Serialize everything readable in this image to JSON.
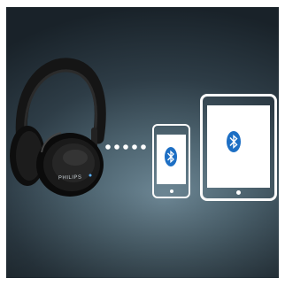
{
  "scene": {
    "background_color": "#3d525c",
    "headphones_brand": "PHILIPS",
    "connection_dots": 5,
    "devices": [
      {
        "type": "smartphone",
        "icon": "bluetooth-icon"
      },
      {
        "type": "tablet",
        "icon": "bluetooth-icon"
      }
    ],
    "bluetooth_color": "#1d6fc4"
  }
}
